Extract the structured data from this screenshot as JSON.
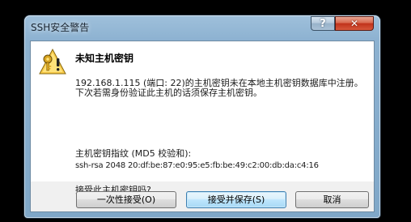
{
  "window": {
    "title": "SSH安全警告",
    "help_label": "?",
    "close_label": "✕"
  },
  "dialog": {
    "heading": "未知主机密钥",
    "message": "192.168.1.115 (端口: 22)的主机密钥未在本地主机密钥数据库中注册。下次若需身份验证此主机的话须保存主机密钥。",
    "fingerprint_label": "主机密钥指纹 (MD5 校验和):",
    "fingerprint_value": "ssh-rsa 2048 20:df:be:87:e0:95:e5:fb:be:49:c2:00:db:da:c4:16",
    "question": "接受此主机密钥吗?",
    "icon": "warning-key-icon"
  },
  "buttons": {
    "accept_once": "一次性接受(O)",
    "accept_save": "接受并保存(S)",
    "cancel": "取消"
  }
}
